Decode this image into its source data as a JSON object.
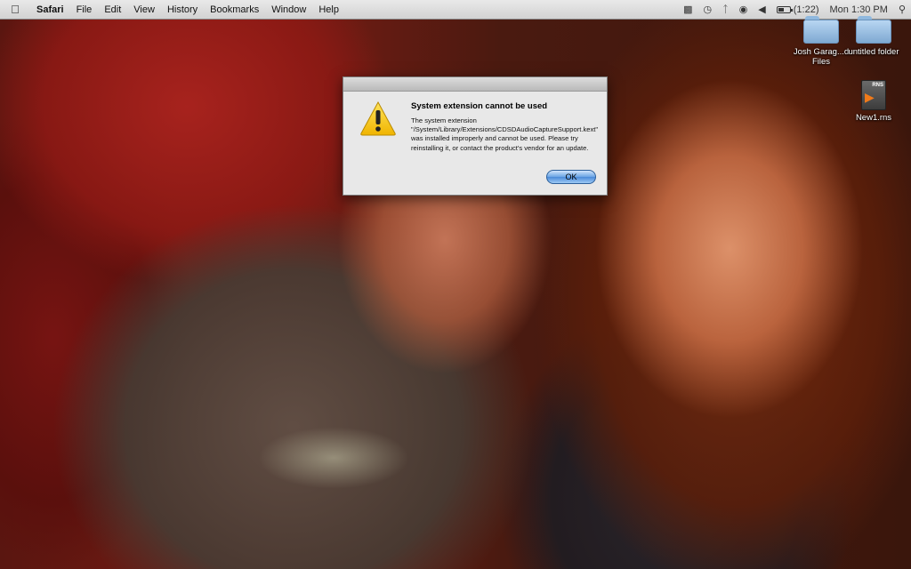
{
  "menubar": {
    "apple_icon": "apple-icon",
    "app_name": "Safari",
    "menus": [
      "File",
      "Edit",
      "View",
      "History",
      "Bookmarks",
      "Window",
      "Help"
    ],
    "battery_text": "(1:22)",
    "clock": "Mon 1:30 PM",
    "status_icons": [
      "tether-icon",
      "time-machine-icon",
      "bluetooth-icon",
      "wifi-icon",
      "volume-icon",
      "battery-icon",
      "spotlight-icon"
    ]
  },
  "desktop": {
    "icons": [
      {
        "label": "Josh Garag...d Files",
        "kind": "folder"
      },
      {
        "label": "untitled folder",
        "kind": "folder"
      },
      {
        "label": "New1.rns",
        "kind": "document",
        "badge": "RNS"
      }
    ]
  },
  "dialog": {
    "title": "System extension cannot be used",
    "message": "The system extension \"/System/Library/Extensions/CDSDAudioCaptureSupport.kext\" was installed improperly and cannot be used. Please try reinstalling it, or contact the product's vendor for an update.",
    "ok_label": "OK",
    "icon": "warning-icon"
  },
  "colors": {
    "accent_button": "#4a8ad8",
    "warning_yellow": "#f5c400",
    "folder_blue": "#8fb8de"
  }
}
